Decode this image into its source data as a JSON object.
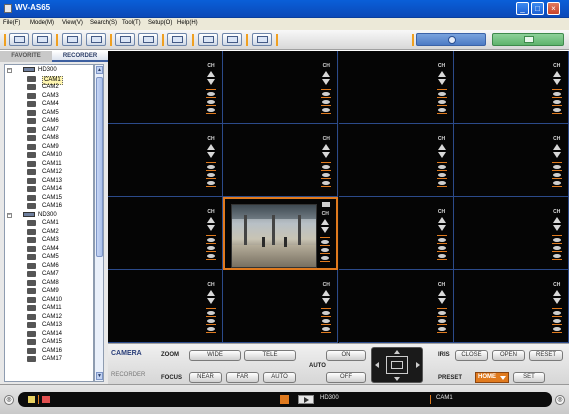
{
  "window": {
    "title": "WV-AS65",
    "minimize": "_",
    "maximize": "□",
    "close": "×"
  },
  "menu": [
    "File(F)",
    "Mode(M)",
    "View(V)",
    "Search(S)",
    "Tool(T)",
    "Setup(O)",
    "Help(H)"
  ],
  "tabs": {
    "favorite": "FAVORITE",
    "recorder": "RECORDER"
  },
  "tree": {
    "recorder1": {
      "name": "HD300",
      "selected": "CAM1",
      "cams": [
        "CAM1",
        "CAM2",
        "CAM3",
        "CAM4",
        "CAM5",
        "CAM6",
        "CAM7",
        "CAM8",
        "CAM9",
        "CAM10",
        "CAM11",
        "CAM12",
        "CAM13",
        "CAM14",
        "CAM15",
        "CAM16"
      ]
    },
    "recorder2": {
      "name": "ND300",
      "cams": [
        "CAM1",
        "CAM2",
        "CAM3",
        "CAM4",
        "CAM5",
        "CAM6",
        "CAM7",
        "CAM8",
        "CAM9",
        "CAM10",
        "CAM11",
        "CAM12",
        "CAM13",
        "CAM14",
        "CAM15",
        "CAM16",
        "CAM17"
      ]
    }
  },
  "grid": {
    "ch_label": "CH",
    "active_cell": 9
  },
  "control": {
    "camera": "CAMERA",
    "recorder": "RECORDER",
    "zoom": "ZOOM",
    "focus": "FOCUS",
    "auto": "AUTO",
    "iris": "IRIS",
    "preset": "PRESET",
    "wide": "WIDE",
    "tele": "TELE",
    "near": "NEAR",
    "far": "FAR",
    "auto_btn": "AUTO",
    "on": "ON",
    "off": "OFF",
    "close": "CLOSE",
    "open": "OPEN",
    "reset": "RESET",
    "home": "HOME",
    "set": "SET"
  },
  "status": {
    "recorder": "HD300",
    "camera": "CAM1"
  },
  "colors": {
    "accent": "#e07a1e",
    "titlebar": "#0a5fd8",
    "grid_line": "#2b4a8a"
  }
}
